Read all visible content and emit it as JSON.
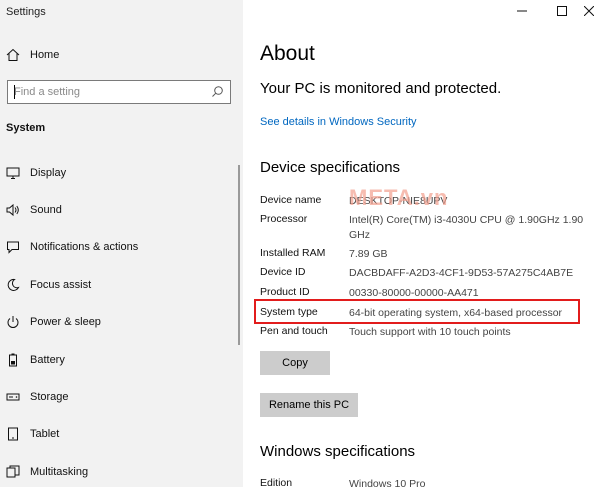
{
  "window": {
    "title": "Settings",
    "controls": [
      "minimize",
      "maximize",
      "close"
    ]
  },
  "sidebar": {
    "home_label": "Home",
    "search": {
      "placeholder": "Find a setting"
    },
    "section_title": "System",
    "items": [
      {
        "label": "Display",
        "icon": "monitor-icon"
      },
      {
        "label": "Sound",
        "icon": "speaker-icon"
      },
      {
        "label": "Notifications & actions",
        "icon": "message-icon"
      },
      {
        "label": "Focus assist",
        "icon": "moon-icon"
      },
      {
        "label": "Power & sleep",
        "icon": "power-icon"
      },
      {
        "label": "Battery",
        "icon": "battery-icon"
      },
      {
        "label": "Storage",
        "icon": "storage-icon"
      },
      {
        "label": "Tablet",
        "icon": "tablet-icon"
      },
      {
        "label": "Multitasking",
        "icon": "multitasking-icon"
      }
    ]
  },
  "main": {
    "title": "About",
    "protection_status": "Your PC is monitored and protected.",
    "security_link": "See details in Windows Security",
    "device_specs": {
      "heading": "Device specifications",
      "rows": [
        {
          "key": "Device name",
          "value": "DESKTOP-NIE8UPV"
        },
        {
          "key": "Processor",
          "value": "Intel(R) Core(TM) i3-4030U CPU @ 1.90GHz   1.90 GHz"
        },
        {
          "key": "Installed RAM",
          "value": "7.89 GB"
        },
        {
          "key": "Device ID",
          "value": "DACBDAFF-A2D3-4CF1-9D53-57A275C4AB7E"
        },
        {
          "key": "Product ID",
          "value": "00330-80000-00000-AA471"
        },
        {
          "key": "System type",
          "value": "64-bit operating system, x64-based processor"
        },
        {
          "key": "Pen and touch",
          "value": "Touch support with 10 touch points"
        }
      ],
      "copy_button": "Copy",
      "rename_button": "Rename this PC"
    },
    "windows_specs": {
      "heading": "Windows specifications",
      "rows": [
        {
          "key": "Edition",
          "value": "Windows 10 Pro"
        }
      ]
    }
  },
  "watermark": "META.vn",
  "colors": {
    "sidebar_bg": "#f2f2f2",
    "link": "#0067c0",
    "highlight_box": "#e21c1c",
    "button_bg": "#cccccc"
  }
}
